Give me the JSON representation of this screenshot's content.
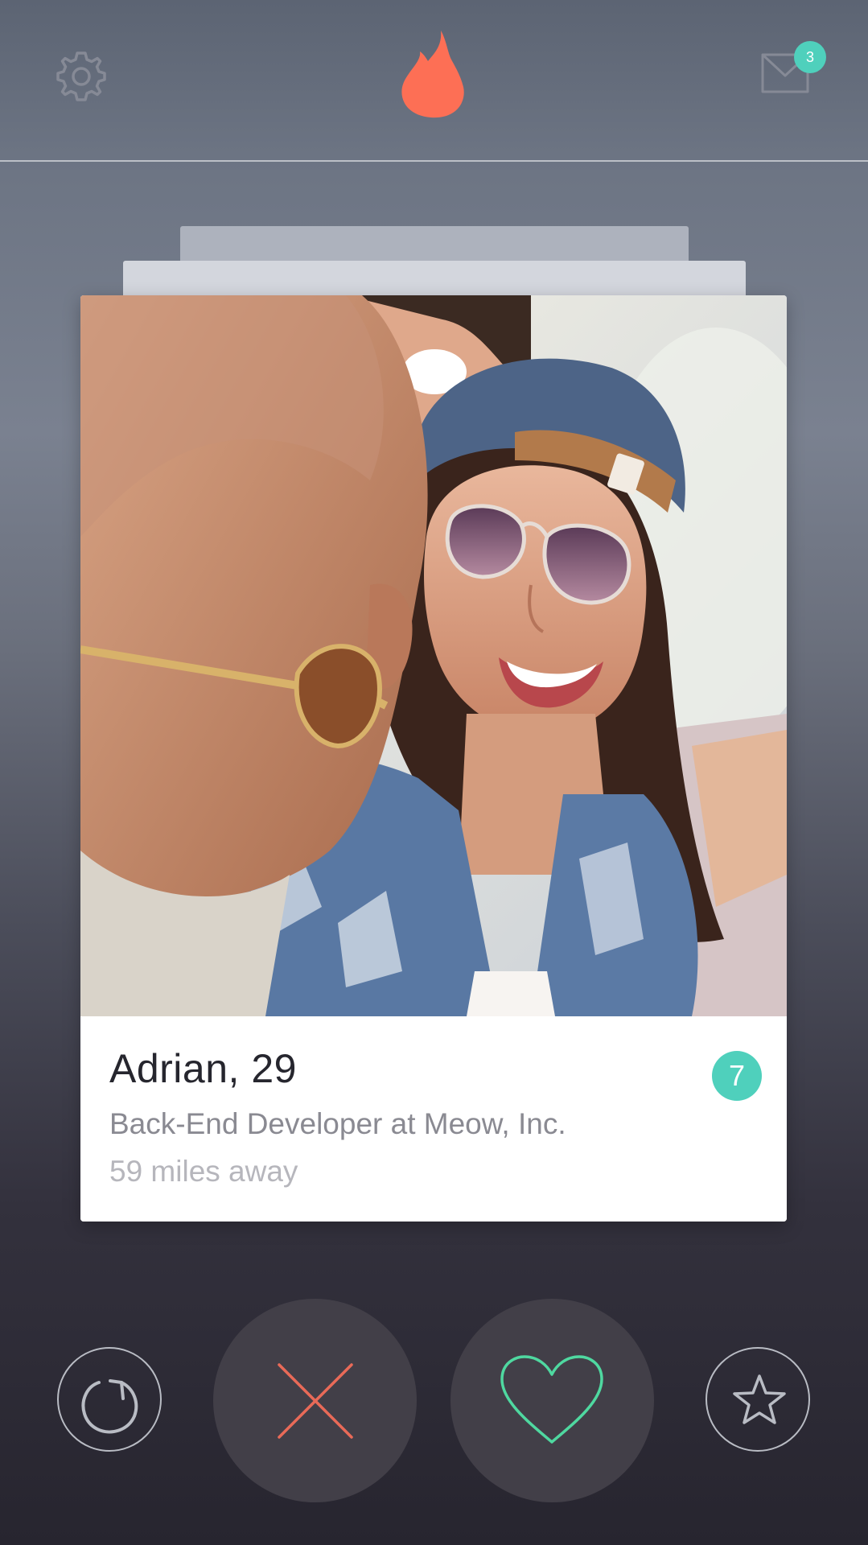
{
  "header": {
    "settings_icon": "gear-icon",
    "logo_icon": "flame-icon",
    "messages_icon": "envelope-icon",
    "messages_badge": "3"
  },
  "profile": {
    "name_age": "Adrian, 29",
    "job": "Back-End Developer at Meow, Inc.",
    "distance": "59 miles away",
    "common_count": "7",
    "photo": "photo of smiling woman in cap and sunglasses"
  },
  "actions": {
    "rewind_icon": "rewind-icon",
    "nope_icon": "close-x-icon",
    "like_icon": "heart-icon",
    "super_like_icon": "star-icon"
  },
  "colors": {
    "brand": "#fd6f55",
    "accent": "#4fd0bc",
    "nope": "#e96a58",
    "like": "#4fd8a0"
  }
}
